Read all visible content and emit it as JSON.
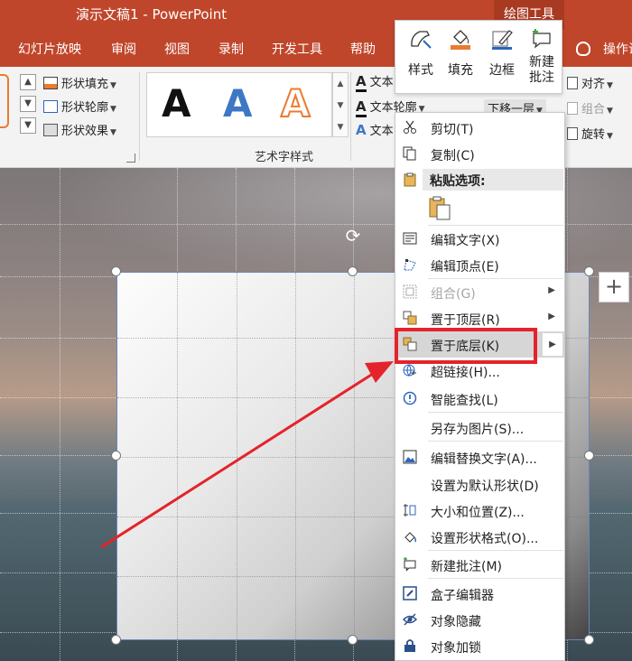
{
  "app": {
    "title": "演示文稿1  -  PowerPoint",
    "context_tab_group": "绘图工具"
  },
  "tabs": [
    "幻灯片放映",
    "审阅",
    "视图",
    "录制",
    "开发工具",
    "帮助",
    "操作说"
  ],
  "ribbon": {
    "shape_fill": "形状填充",
    "shape_outline": "形状轮廓",
    "shape_effects": "形状效果",
    "wordart_letter": "A",
    "wordart_group_label": "艺术字样式",
    "text_fill": "文本",
    "text_outline": "文本轮廓",
    "text_effects": "文本",
    "send_backward": "下移一层",
    "align": "对齐",
    "group": "组合",
    "rotate": "旋转"
  },
  "mini_toolbar": {
    "style": "样式",
    "fill": "填充",
    "outline": "边框",
    "new_comment": "新建批注"
  },
  "context_menu": {
    "cut": "剪切(T)",
    "copy": "复制(C)",
    "paste_options": "粘贴选项:",
    "edit_text": "编辑文字(X)",
    "edit_points": "编辑顶点(E)",
    "group": "组合(G)",
    "bring_to_front": "置于顶层(R)",
    "send_to_back": "置于底层(K)",
    "hyperlink": "超链接(H)...",
    "smart_lookup": "智能查找(L)",
    "save_as_picture": "另存为图片(S)...",
    "edit_alt_text": "编辑替换文字(A)...",
    "set_default_shape": "设置为默认形状(D)",
    "size_position": "大小和位置(Z)...",
    "format_shape": "设置形状格式(O)...",
    "new_comment": "新建批注(M)",
    "box_editor": "盒子编辑器",
    "hide_object": "对象隐藏",
    "lock_object": "对象加锁"
  },
  "colors": {
    "accent": "#c0462b",
    "highlight": "#e4232b",
    "wordart_blue": "#3d78c4",
    "wordart_orange": "#ec7a2f"
  }
}
